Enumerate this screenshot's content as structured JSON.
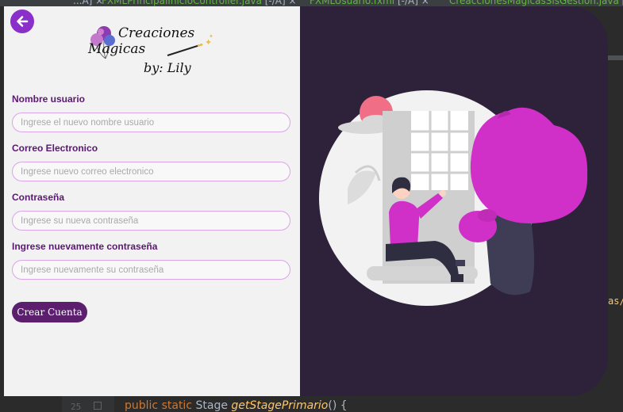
{
  "ide": {
    "tabs": [
      {
        "text": "...A] ×"
      },
      {
        "file": "FXMLPrincipalInicioController.java",
        "suffix": " [-/A] ×"
      },
      {
        "file": "FXMLUsuario.fxml",
        "suffix": " [-/A] ×"
      },
      {
        "file": "CreaccionesMagicasSisGestion.java",
        "suffix": " [-/"
      }
    ],
    "right_fragment": "as/",
    "line_number": "25",
    "code": {
      "kw1": "public",
      "kw2": "static",
      "type": "Stage",
      "method": "getStagePrimario",
      "rest": "() {"
    }
  },
  "app": {
    "logo": {
      "line1": "Creaciones",
      "line2": "Magicas",
      "line3": "by: Lily"
    },
    "form": {
      "fields": [
        {
          "label": "Nombre usuario",
          "placeholder": "Ingrese el nuevo nombre usuario",
          "value": ""
        },
        {
          "label": "Correo Electronico",
          "placeholder": "Ingrese nuevo correo electronico",
          "value": ""
        },
        {
          "label": "Contraseña",
          "placeholder": "Ingrese su nueva contraseña",
          "value": ""
        },
        {
          "label": "Ingrese nuevamente contraseña",
          "placeholder": "Ingrese nuevamente su contraseña",
          "value": ""
        }
      ],
      "submit_label": "Crear Cuenta"
    },
    "icons": {
      "back": "arrow-left-icon",
      "illustration": "woman-sitting-under-tree-illustration"
    },
    "colors": {
      "accent": "#8a2fc9",
      "label": "#5b1773",
      "button": "#5b1f6e",
      "panel_dark": "#2e223b",
      "tree": "#d030c8"
    }
  }
}
